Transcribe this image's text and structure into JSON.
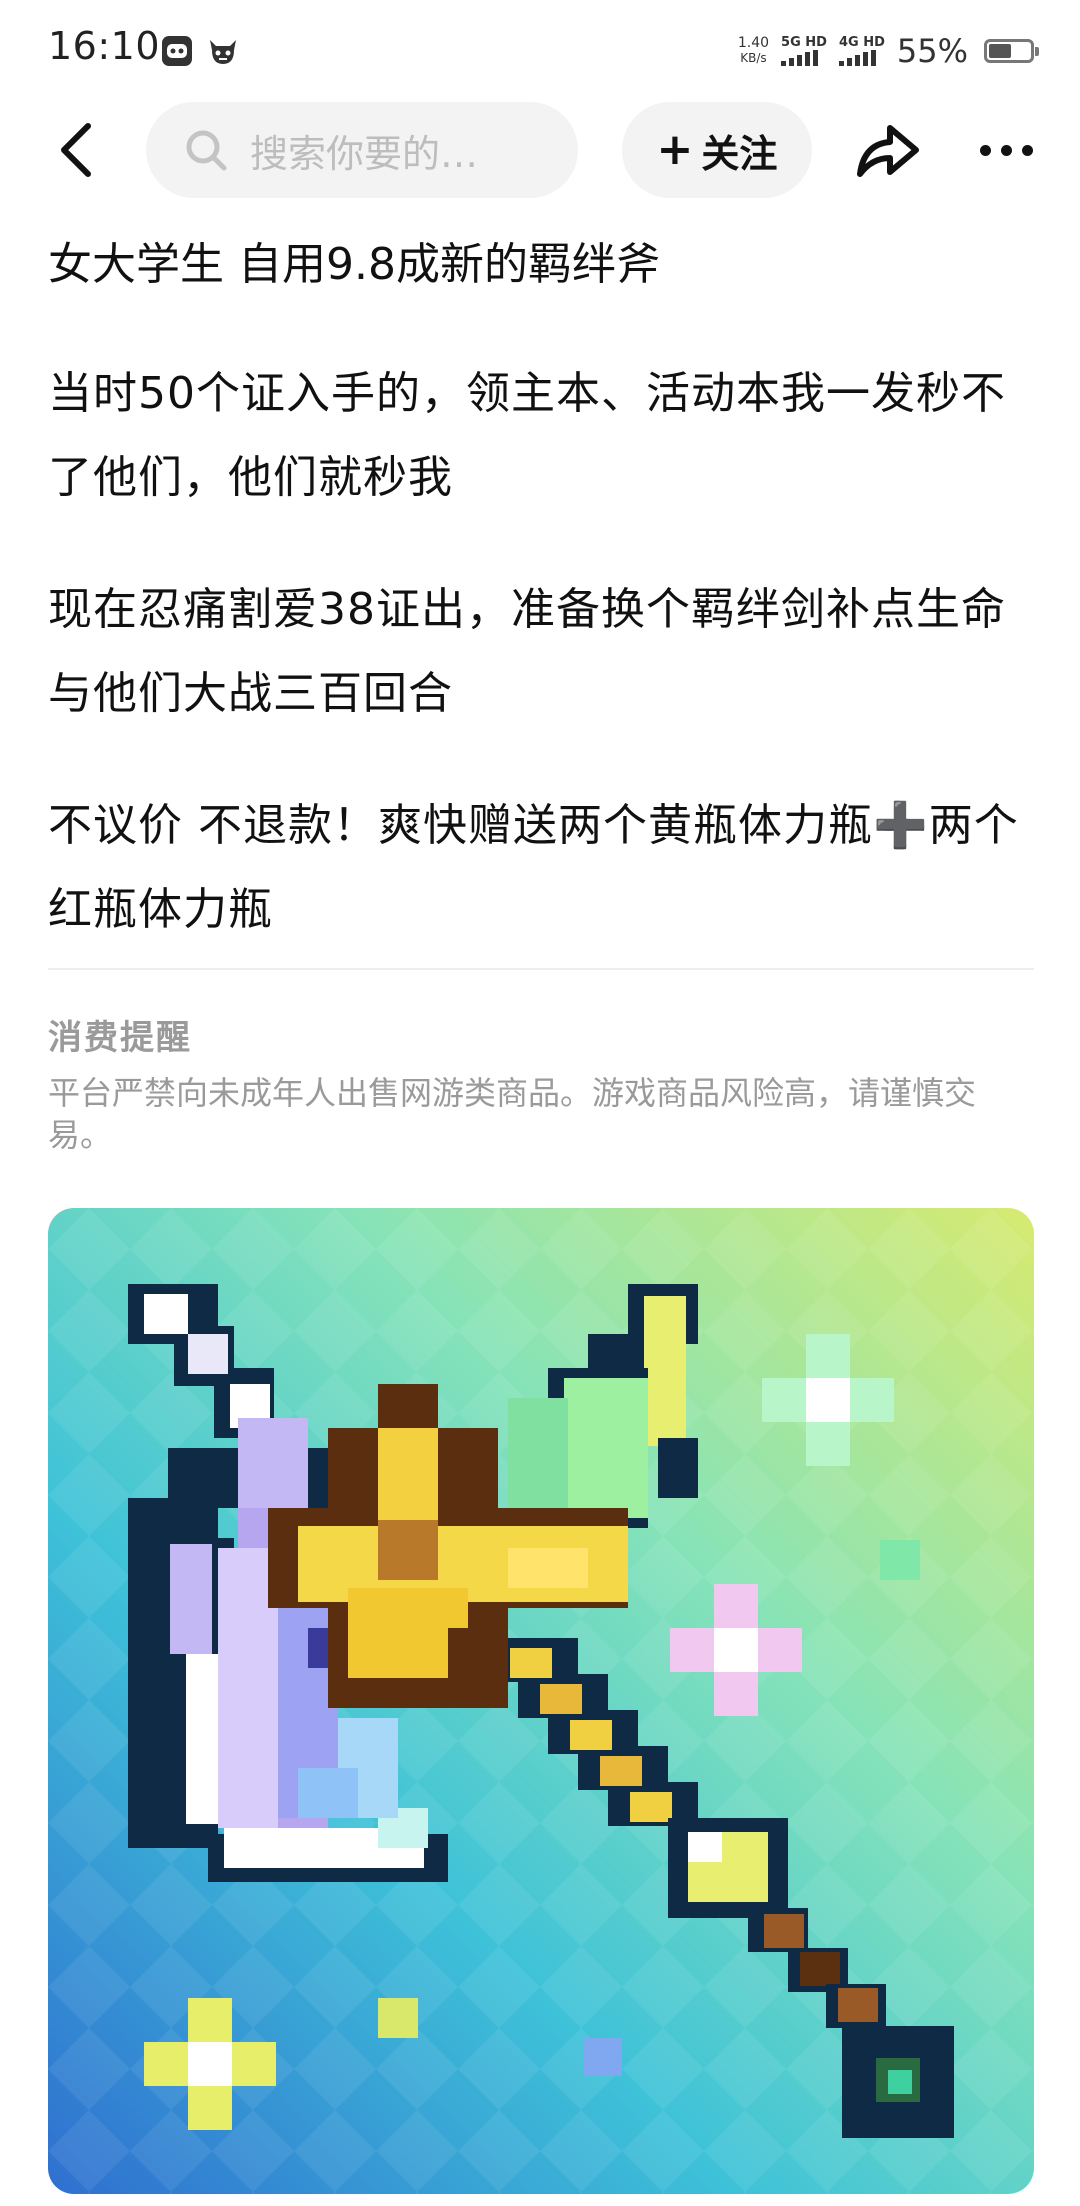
{
  "status_bar": {
    "time": "16:10",
    "net_speed_value": "1.40",
    "net_speed_unit": "KB/s",
    "sim1_label": "5G HD",
    "sim2_label": "4G HD",
    "battery_percent": "55%",
    "battery_level": 0.55
  },
  "header": {
    "search_placeholder": "搜索你要的…",
    "follow_label": "关注",
    "follow_plus": "+",
    "icons": {
      "back": "chevron-left-icon",
      "search": "search-icon",
      "share": "share-arrow-icon",
      "more": "more-dots-icon"
    }
  },
  "post": {
    "title": "女大学生 自用9.8成新的羁绊斧",
    "paragraphs": [
      "当时50个证入手的，领主本、活动本我一发秒不了他们，他们就秒我",
      "现在忍痛割爱38证出，准备换个羁绊剑补点生命与他们大战三百回合",
      "不议价 不退款！爽快赠送两个黄瓶体力瓶➕两个红瓶体力瓶"
    ]
  },
  "notice": {
    "title": "消费提醒",
    "text": "平台严禁向未成年人出售网游类商品。游戏商品风险高，请谨慎交易。"
  },
  "colors": {
    "text_primary": "#111111",
    "text_muted": "#9a9a9a",
    "pill_bg": "#f3f3f3"
  }
}
